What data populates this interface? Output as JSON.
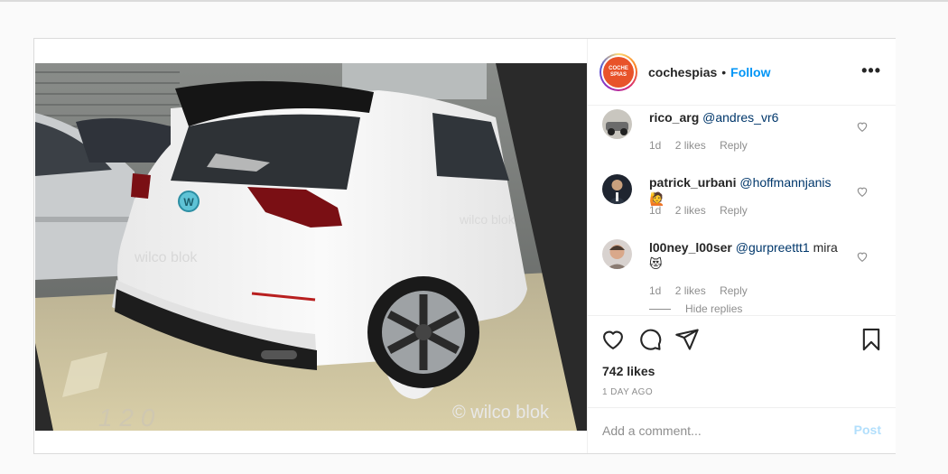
{
  "post": {
    "username": "cochespias",
    "separator": "•",
    "follow_label": "Follow",
    "more_label": "•••",
    "avatar_logo_text": "COCHE\nSPIAS",
    "image_watermark": "© wilco blok",
    "image_watermark_faint": "wilco blok",
    "image_floor_marking": "1 2 0"
  },
  "comments": [
    {
      "username": "rico_arg",
      "mention": "@andres_vr6",
      "text": "",
      "age": "1d",
      "likes": "2 likes",
      "reply_label": "Reply"
    },
    {
      "username": "patrick_urbani",
      "mention": "@hoffmannjanis",
      "text": "",
      "emoji": "🙋",
      "age": "1d",
      "likes": "2 likes",
      "reply_label": "Reply"
    },
    {
      "username": "l00ney_l00ser",
      "mention": "@gurpreettt1",
      "text": "mira",
      "emoji": "😻",
      "age": "1d",
      "likes": "2 likes",
      "reply_label": "Reply"
    }
  ],
  "hide_replies_label": "Hide replies",
  "stats": {
    "likes": "742 likes",
    "time_ago": "1 DAY AGO"
  },
  "add_comment": {
    "placeholder": "Add a comment...",
    "post_label": "Post"
  },
  "colors": {
    "follow": "#0095f6",
    "post_disabled": "#b2dffc",
    "muted": "#8e8e8e",
    "mention": "#00376b",
    "border": "#dbdbdb"
  },
  "icons": {
    "like": "heart-icon",
    "comment": "comment-icon",
    "share": "share-icon",
    "save": "bookmark-icon",
    "more": "more-options-icon",
    "comment_like": "small-heart-icon"
  }
}
